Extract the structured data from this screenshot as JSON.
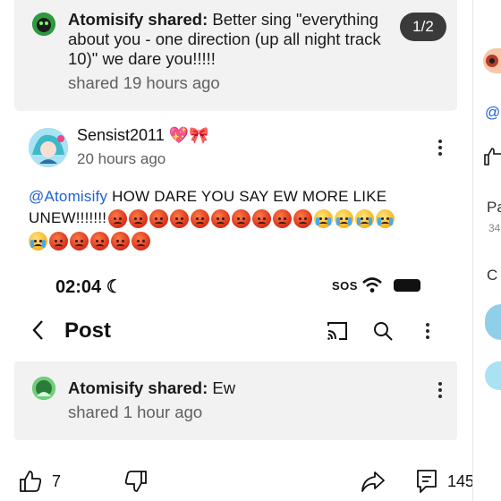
{
  "top_shared": {
    "author_prefix": "Atomisify shared:",
    "text_line1": "Better sing \"everything",
    "text_line2": "about you - one direction (up all night track",
    "text_line3": "10)\" we dare you!!!!!",
    "meta": "shared 19 hours ago"
  },
  "pager": "1/2",
  "comment": {
    "username": "Sensist2011",
    "time": "20 hours ago",
    "mention": "@Atomisify",
    "text_line1": " HOW DARE YOU SAY EW MORE LIKE",
    "text_line2": "UNEW!!!!!!!",
    "emoji_row1": [
      "angry",
      "angry",
      "angry",
      "angry",
      "angry",
      "angry",
      "angry",
      "angry",
      "angry",
      "angry",
      "cry",
      "cry",
      "cry",
      "cry"
    ],
    "emoji_row2": [
      "cry",
      "angry",
      "angry",
      "angry",
      "angry",
      "angry"
    ]
  },
  "status_bar": {
    "time": "02:04",
    "sos": "SOS"
  },
  "post_header": {
    "title": "Post"
  },
  "bottom_shared": {
    "author_prefix": "Atomisify shared:",
    "text": "Ew",
    "meta": "shared 1 hour ago"
  },
  "actions": {
    "like_count": "7",
    "comment_count": "145"
  },
  "right_column": {
    "letter_p": "Pa",
    "small_num": "34",
    "letter_c": "C",
    "at": "@"
  }
}
